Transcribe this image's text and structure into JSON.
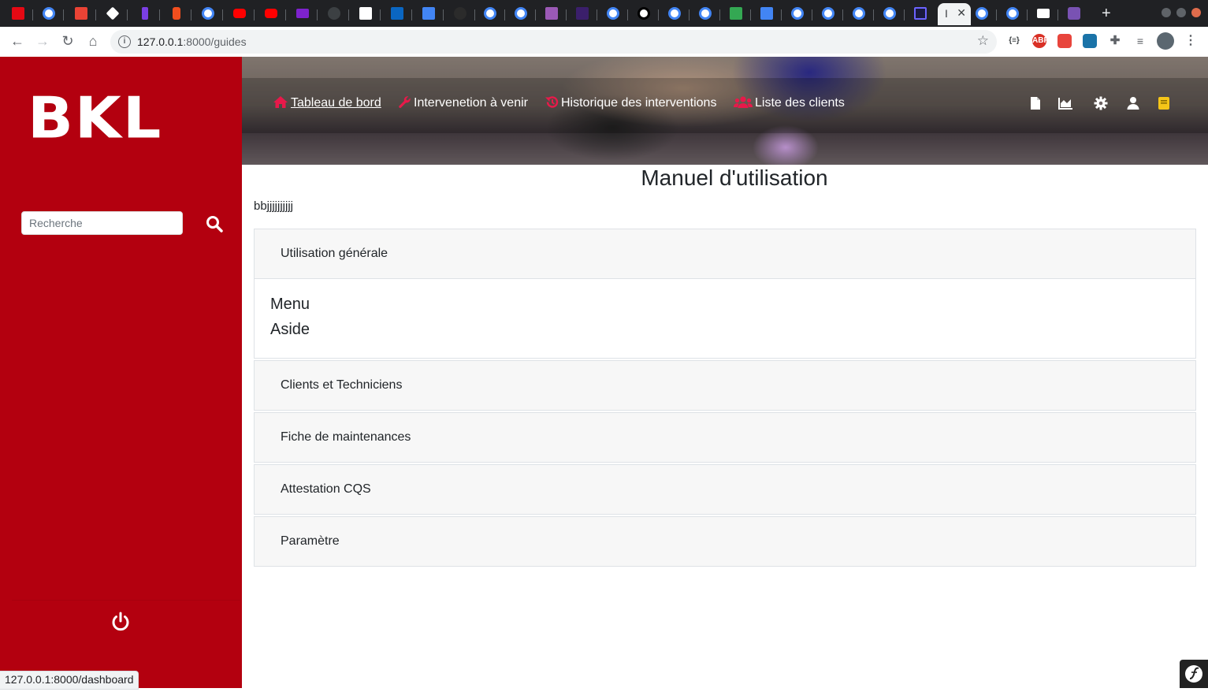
{
  "browser": {
    "active_tab_title": "I",
    "new_tab_label": "+",
    "url_host": "127.0.0.1",
    "url_path": ":8000/guides",
    "status_url": "127.0.0.1:8000/dashboard"
  },
  "sidebar": {
    "logo": "BKL",
    "search_placeholder": "Recherche"
  },
  "header": {
    "nav": [
      {
        "label": "Tableau de bord",
        "icon": "home-icon",
        "current": true
      },
      {
        "label": "Intervenetion à venir",
        "icon": "wrench-icon",
        "current": false
      },
      {
        "label": "Historique des interventions",
        "icon": "history-icon",
        "current": false
      },
      {
        "label": "Liste des clients",
        "icon": "users-icon",
        "current": false
      }
    ],
    "icons": [
      "file-icon",
      "chart-area-icon",
      "gear-icon",
      "user-icon",
      "book-icon"
    ]
  },
  "main": {
    "title": "Manuel d'utilisation",
    "intro": "bbjjjjjjjjjj",
    "sections": [
      {
        "title": "Utilisation générale",
        "expanded": true,
        "items": [
          "Menu",
          "Aside"
        ]
      },
      {
        "title": "Clients et Techniciens",
        "expanded": false
      },
      {
        "title": "Fiche de maintenances",
        "expanded": false
      },
      {
        "title": "Attestation CQS",
        "expanded": false
      },
      {
        "title": "Paramètre",
        "expanded": false
      }
    ]
  },
  "colors": {
    "sidebar": "#b3000f",
    "nav_icon": "#e8194a",
    "book_icon": "#f5c518"
  }
}
